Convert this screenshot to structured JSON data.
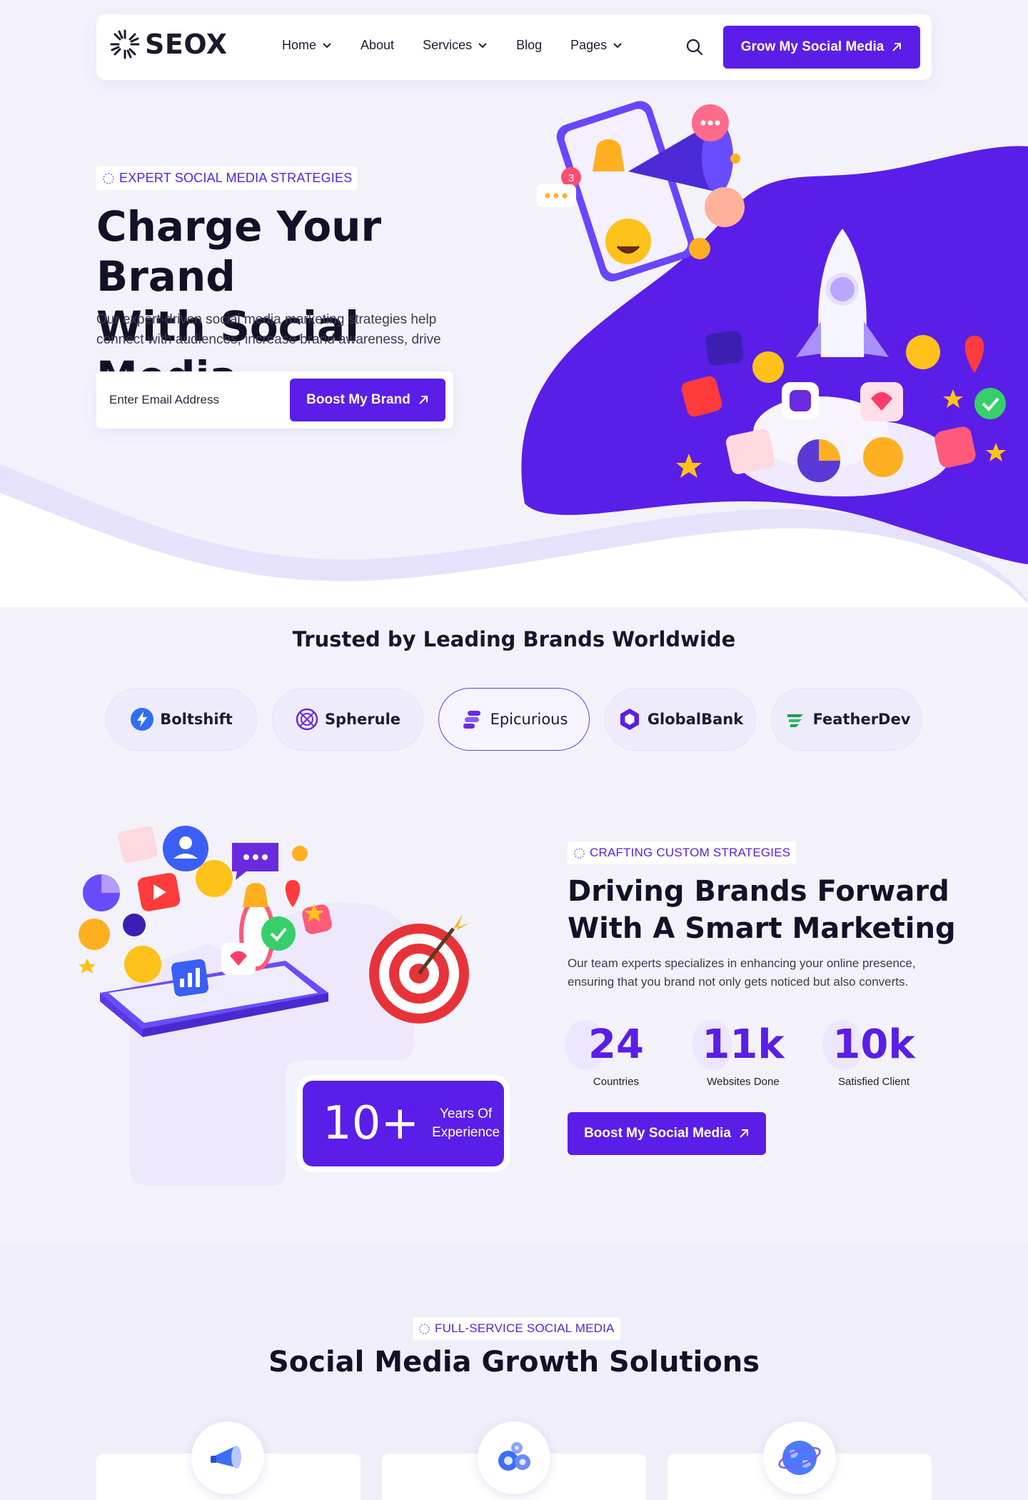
{
  "nav": {
    "logo": "SEOX",
    "items": [
      {
        "label": "Home",
        "has_dropdown": true
      },
      {
        "label": "About",
        "has_dropdown": false
      },
      {
        "label": "Services",
        "has_dropdown": true
      },
      {
        "label": "Blog",
        "has_dropdown": false
      },
      {
        "label": "Pages",
        "has_dropdown": true
      }
    ],
    "search_icon": "search-icon",
    "cta_label": "Grow My Social Media"
  },
  "hero": {
    "badge": "EXPERT SOCIAL MEDIA STRATEGIES",
    "title_line1": "Charge Your Brand",
    "title_line2": "With Social Media",
    "description": "Our expert-driven social media marketing strategies help connect with audiences, increase brand awareness, drive",
    "email_placeholder": "Enter Email Address",
    "button_label": "Boost My Brand",
    "notification_count": "3"
  },
  "trusted": {
    "title": "Trusted by Leading Brands Worldwide",
    "brands": [
      {
        "name": "Boltshift",
        "icon": "bolt-icon"
      },
      {
        "name": "Spherule",
        "icon": "sphere-icon"
      },
      {
        "name": "Epicurious",
        "icon": "stack-icon"
      },
      {
        "name": "GlobalBank",
        "icon": "hexagon-icon"
      },
      {
        "name": "FeatherDev",
        "icon": "feather-icon"
      }
    ]
  },
  "about": {
    "badge": "CRAFTING CUSTOM STRATEGIES",
    "title_line1": "Driving Brands Forward",
    "title_line2": "With A Smart Marketing",
    "description": "Our team experts specializes in enhancing your online presence, ensuring that you brand not only gets noticed but also converts.",
    "stats": [
      {
        "value": "24",
        "label": "Countries"
      },
      {
        "value": "11k",
        "label": "Websites Done"
      },
      {
        "value": "10k",
        "label": "Satisfied Client"
      }
    ],
    "button_label": "Boost My Social Media",
    "experience_value": "10+",
    "experience_label_line1": "Years Of",
    "experience_label_line2": "Experience"
  },
  "services": {
    "badge": "FULL-SERVICE SOCIAL MEDIA",
    "title": "Social Media Growth Solutions",
    "icons": [
      "megaphone-icon",
      "gears-icon",
      "globe-icon"
    ]
  },
  "colors": {
    "primary": "#5a1ee8",
    "background": "#f3f2fb",
    "text": "#17162b"
  }
}
